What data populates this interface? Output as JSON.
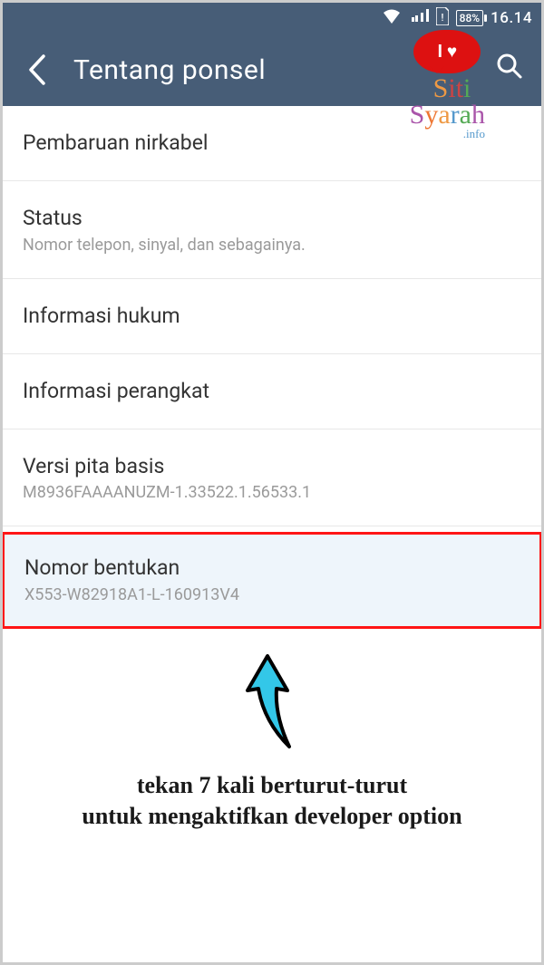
{
  "statusbar": {
    "battery_pct": "88%",
    "time": "16.14"
  },
  "appbar": {
    "title": "Tentang ponsel"
  },
  "watermark": {
    "bubble": "I ♥",
    "line1": "Siti",
    "line2": "Syarah",
    "suffix": ".info"
  },
  "items": [
    {
      "title": "Pembaruan nirkabel",
      "sub": ""
    },
    {
      "title": "Status",
      "sub": "Nomor telepon, sinyal, dan sebagainya."
    },
    {
      "title": "Informasi hukum",
      "sub": ""
    },
    {
      "title": "Informasi perangkat",
      "sub": ""
    },
    {
      "title": "Versi pita basis",
      "sub": "M8936FAAAANUZM-1.33522.1.56533.1"
    },
    {
      "title": "Nomor bentukan",
      "sub": "X553-W82918A1-L-160913V4"
    }
  ],
  "annotation": {
    "line1": "tekan 7 kali berturut-turut",
    "line2": "untuk mengaktifkan developer option"
  }
}
